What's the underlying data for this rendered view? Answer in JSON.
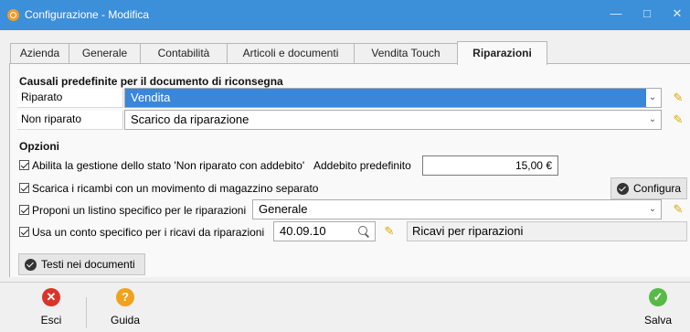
{
  "window": {
    "title": "Configurazione - Modifica",
    "controls": {
      "minimize": "—",
      "maximize": "□",
      "close": "✕"
    }
  },
  "tabs": [
    {
      "label": "Azienda"
    },
    {
      "label": "Generale"
    },
    {
      "label": "Contabilità"
    },
    {
      "label": "Articoli e documenti"
    },
    {
      "label": "Vendita Touch"
    },
    {
      "label": "Riparazioni",
      "active": true
    }
  ],
  "causali": {
    "heading": "Causali predefinite per il documento di riconsegna",
    "riparato": {
      "label": "Riparato",
      "value": "Vendita"
    },
    "non_riparato": {
      "label": "Non riparato",
      "value": "Scarico da riparazione"
    }
  },
  "opzioni": {
    "heading": "Opzioni",
    "stato_non_riparato": {
      "label": "Abilita la gestione dello stato 'Non riparato con addebito'",
      "checked": true,
      "addebito_label": "Addebito predefinito",
      "addebito_value": "15,00 €"
    },
    "scarica_ricambi": {
      "label": "Scarica i ricambi con un movimento di magazzino separato",
      "checked": true,
      "button_label": "Configura"
    },
    "listino": {
      "label": "Proponi un listino specifico per le riparazioni",
      "checked": true,
      "value": "Generale"
    },
    "conto": {
      "label": "Usa un conto specifico per i ricavi da riparazioni",
      "checked": true,
      "code": "40.09.10",
      "description": "Ricavi per riparazioni"
    },
    "testi_button": "Testi nei documenti"
  },
  "footer": {
    "esci": "Esci",
    "guida": "Guida",
    "salva": "Salva"
  },
  "colors": {
    "titlebar": "#3c8fd9",
    "selection": "#3b86d8",
    "esci": "#d9342b",
    "guida": "#f0a21b",
    "salva": "#58b947",
    "pencil": "#e0a800"
  }
}
